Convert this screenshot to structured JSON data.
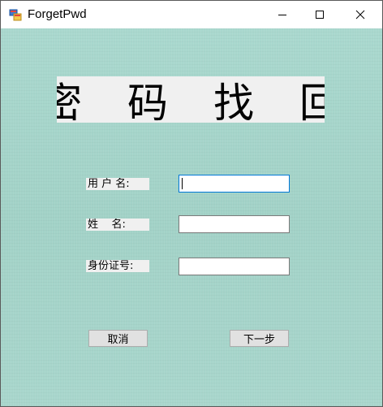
{
  "window": {
    "title": "ForgetPwd",
    "icon": "winforms-app-icon",
    "controls": {
      "minimize_icon": "minimize-icon",
      "maximize_icon": "maximize-icon",
      "close_icon": "close-icon"
    }
  },
  "colors": {
    "background": "#a6d5cb",
    "label_bg": "#f0f0f0",
    "focus_border": "#0078d7",
    "button_bg": "#e1e1e1"
  },
  "form": {
    "heading": "密 码 找 回",
    "fields": {
      "username": {
        "label": "用 户 名:",
        "value": ""
      },
      "name": {
        "label": "姓    名:",
        "value": ""
      },
      "id_number": {
        "label": "身份证号:",
        "value": ""
      }
    },
    "buttons": {
      "cancel": "取消",
      "next": "下一步"
    }
  }
}
